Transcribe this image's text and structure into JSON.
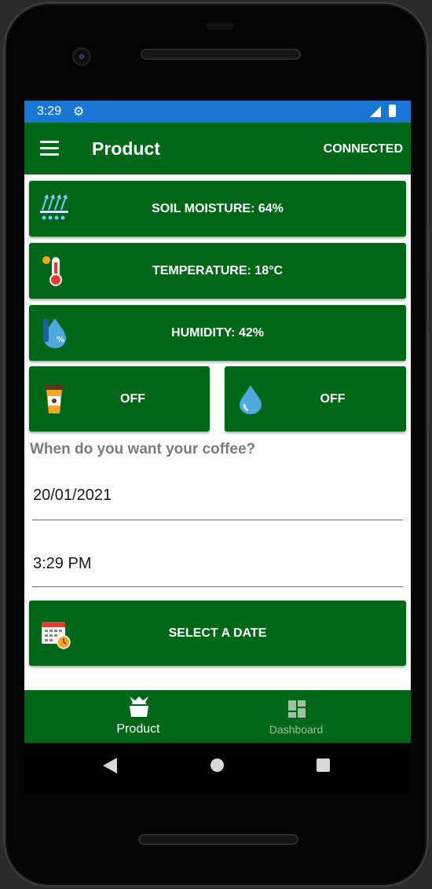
{
  "status_bar": {
    "time": "3:29",
    "settings_icon": "gear-icon",
    "signal_icon": "signal-icon",
    "battery_icon": "battery-icon"
  },
  "app_bar": {
    "menu_icon": "hamburger-icon",
    "title": "Product",
    "connection_status": "CONNECTED"
  },
  "sensors": [
    {
      "icon": "soil-moisture-icon",
      "label": "SOIL MOISTURE: 64%"
    },
    {
      "icon": "thermometer-icon",
      "label": "TEMPERATURE: 18°C"
    },
    {
      "icon": "humidity-icon",
      "label": "HUMIDITY: 42%"
    }
  ],
  "toggles": [
    {
      "icon": "coffee-cup-icon",
      "label": "OFF"
    },
    {
      "icon": "water-drop-icon",
      "label": "OFF"
    }
  ],
  "schedule": {
    "question": "When do you want your coffee?",
    "date_value": "20/01/2021",
    "time_value": "3:29 PM",
    "select_button_label": "SELECT A DATE",
    "select_button_icon": "calendar-clock-icon"
  },
  "bottom_nav": [
    {
      "icon": "plant-icon",
      "label": "Product",
      "active": true
    },
    {
      "icon": "dashboard-icon",
      "label": "Dashboard",
      "active": false
    }
  ],
  "colors": {
    "primary": "#006618",
    "status_bar": "#1976d2",
    "question_text": "#7b7b7b"
  }
}
